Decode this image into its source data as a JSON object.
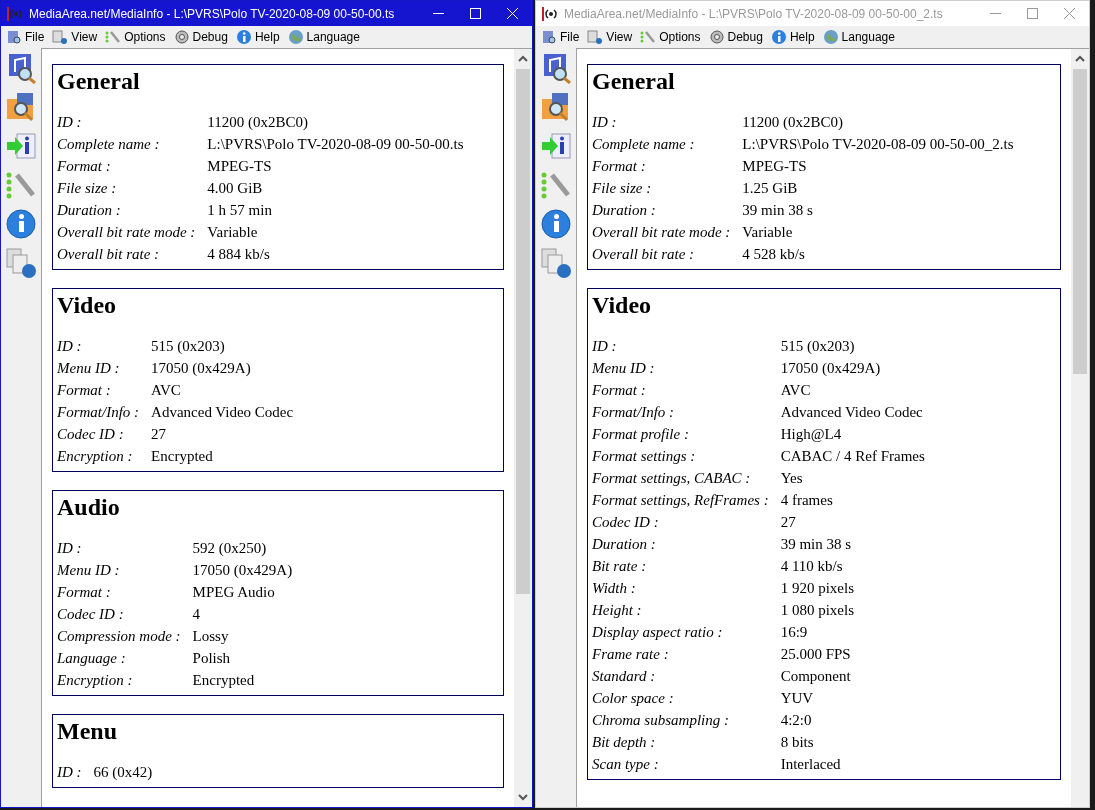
{
  "windows": [
    {
      "title": "MediaArea.net/MediaInfo - L:\\PVRS\\Polo TV-2020-08-09 00-50-00.ts",
      "active": true,
      "menu": [
        "File",
        "View",
        "Options",
        "Debug",
        "Help",
        "Language"
      ],
      "sections": [
        {
          "heading": "General",
          "rows": [
            {
              "label": "ID :",
              "value": "11200 (0x2BC0)"
            },
            {
              "label": "Complete name :",
              "value": "L:\\PVRS\\Polo TV-2020-08-09 00-50-00.ts"
            },
            {
              "label": "Format :",
              "value": "MPEG-TS"
            },
            {
              "label": "File size :",
              "value": "4.00 GiB"
            },
            {
              "label": "Duration :",
              "value": "1 h 57 min"
            },
            {
              "label": "Overall bit rate mode :",
              "value": "Variable"
            },
            {
              "label": "Overall bit rate :",
              "value": "4 884 kb/s"
            }
          ]
        },
        {
          "heading": "Video",
          "rows": [
            {
              "label": "ID :",
              "value": "515 (0x203)"
            },
            {
              "label": "Menu ID :",
              "value": "17050 (0x429A)"
            },
            {
              "label": "Format :",
              "value": "AVC"
            },
            {
              "label": "Format/Info :",
              "value": "Advanced Video Codec"
            },
            {
              "label": "Codec ID :",
              "value": "27"
            },
            {
              "label": "Encryption :",
              "value": "Encrypted"
            }
          ]
        },
        {
          "heading": "Audio",
          "rows": [
            {
              "label": "ID :",
              "value": "592 (0x250)"
            },
            {
              "label": "Menu ID :",
              "value": "17050 (0x429A)"
            },
            {
              "label": "Format :",
              "value": "MPEG Audio"
            },
            {
              "label": "Codec ID :",
              "value": "4"
            },
            {
              "label": "Compression mode :",
              "value": "Lossy"
            },
            {
              "label": "Language :",
              "value": "Polish"
            },
            {
              "label": "Encryption :",
              "value": "Encrypted"
            }
          ]
        },
        {
          "heading": "Menu",
          "rows": [
            {
              "label": "ID :",
              "value": "66 (0x42)"
            }
          ]
        }
      ]
    },
    {
      "title": "MediaArea.net/MediaInfo - L:\\PVRS\\Polo TV-2020-08-09 00-50-00_2.ts",
      "active": false,
      "menu": [
        "File",
        "View",
        "Options",
        "Debug",
        "Help",
        "Language"
      ],
      "sections": [
        {
          "heading": "General",
          "rows": [
            {
              "label": "ID :",
              "value": "11200 (0x2BC0)"
            },
            {
              "label": "Complete name :",
              "value": "L:\\PVRS\\Polo TV-2020-08-09 00-50-00_2.ts"
            },
            {
              "label": "Format :",
              "value": "MPEG-TS"
            },
            {
              "label": "File size :",
              "value": "1.25 GiB"
            },
            {
              "label": "Duration :",
              "value": "39 min 38 s"
            },
            {
              "label": "Overall bit rate mode :",
              "value": "Variable"
            },
            {
              "label": "Overall bit rate :",
              "value": "4 528 kb/s"
            }
          ]
        },
        {
          "heading": "Video",
          "rows": [
            {
              "label": "ID :",
              "value": "515 (0x203)"
            },
            {
              "label": "Menu ID :",
              "value": "17050 (0x429A)"
            },
            {
              "label": "Format :",
              "value": "AVC"
            },
            {
              "label": "Format/Info :",
              "value": "Advanced Video Codec"
            },
            {
              "label": "Format profile :",
              "value": "High@L4"
            },
            {
              "label": "Format settings :",
              "value": "CABAC / 4 Ref Frames"
            },
            {
              "label": "Format settings, CABAC :",
              "value": "Yes"
            },
            {
              "label": "Format settings, RefFrames :",
              "value": "4 frames"
            },
            {
              "label": "Codec ID :",
              "value": "27"
            },
            {
              "label": "Duration :",
              "value": "39 min 38 s"
            },
            {
              "label": "Bit rate :",
              "value": "4 110 kb/s"
            },
            {
              "label": "Width :",
              "value": "1 920 pixels"
            },
            {
              "label": "Height :",
              "value": "1 080 pixels"
            },
            {
              "label": "Display aspect ratio :",
              "value": "16:9"
            },
            {
              "label": "Frame rate :",
              "value": "25.000 FPS"
            },
            {
              "label": "Standard :",
              "value": "Component"
            },
            {
              "label": "Color space :",
              "value": "YUV"
            },
            {
              "label": "Chroma subsampling :",
              "value": "4:2:0"
            },
            {
              "label": "Bit depth :",
              "value": "8 bits"
            },
            {
              "label": "Scan type :",
              "value": "Interlaced"
            }
          ]
        }
      ]
    }
  ]
}
